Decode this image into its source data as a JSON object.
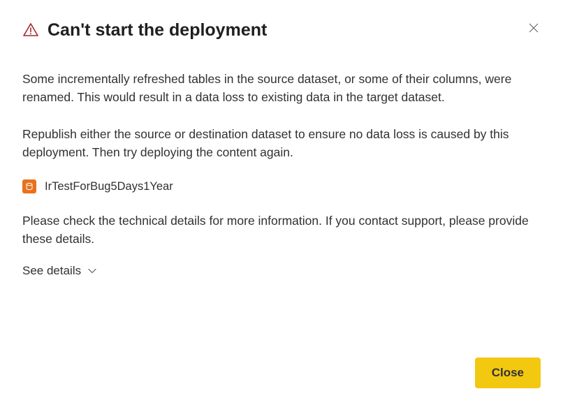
{
  "dialog": {
    "title": "Can't start the deployment",
    "paragraph1": "Some incrementally refreshed tables in the source dataset, or some of their columns, were renamed. This would result in a data loss to existing data in the target dataset.",
    "paragraph2": "Republish either the source or destination dataset to ensure no data loss is caused by this deployment. Then try deploying the content again.",
    "dataset_name": "IrTestForBug5Days1Year",
    "paragraph3": "Please check the technical details for more information. If you contact support, please provide these details.",
    "see_details_label": "See details",
    "close_button_label": "Close",
    "close_x_aria": "Close dialog"
  },
  "colors": {
    "warning_red": "#a4262c",
    "dataset_orange": "#e8711c",
    "primary_yellow": "#f2c811"
  }
}
